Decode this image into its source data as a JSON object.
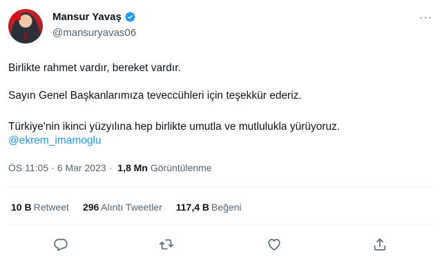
{
  "author": {
    "name": "Mansur Yavaş",
    "handle": "@mansuryavas06",
    "verified_icon": "verified-badge-icon",
    "avatar": "profile-photo"
  },
  "more_icon": "more-options-icon",
  "more_label": "···",
  "tweet": {
    "line1": "Birlikte rahmet vardır, bereket vardır.",
    "line2": "Sayın Genel Başkanlarımıza teveccühleri için teşekkür ederiz.",
    "line3": "Türkiye'nin ikinci yüzyılına hep birlikte umutla ve mutlulukla yürüyoruz.",
    "mention": "@ekrem_imamoglu"
  },
  "meta": {
    "time": "ÖS 11:05",
    "separator1": "·",
    "date": "6 Mar 2023",
    "separator2": "·",
    "views_count": "1,8 Mn",
    "views_label": "Görüntülenme"
  },
  "stats": {
    "retweets_count": "10 B",
    "retweets_label": "Retweet",
    "quotes_count": "296",
    "quotes_label": "Alıntı Tweetler",
    "likes_count": "117,4 B",
    "likes_label": "Beğeni"
  },
  "actions": {
    "reply_icon": "reply-icon",
    "retweet_icon": "retweet-icon",
    "like_icon": "like-icon",
    "share_icon": "share-icon"
  },
  "colors": {
    "accent": "#1d9bf0",
    "secondary_text": "#536471",
    "primary_text": "#0f1419"
  }
}
